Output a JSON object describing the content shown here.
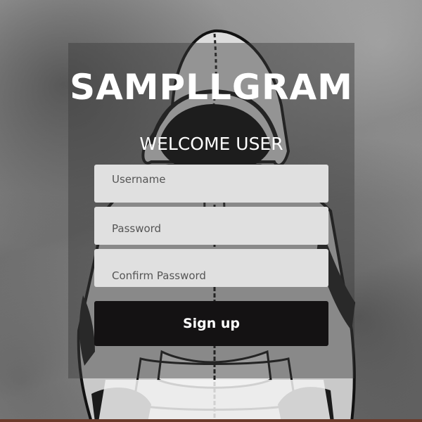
{
  "brand": {
    "logo_text": "SAMPLLGRAM"
  },
  "heading": {
    "welcome": "WELCOME USER"
  },
  "form": {
    "username_placeholder": "Username",
    "password_placeholder": "Password",
    "confirm_placeholder": "Confirm Password",
    "submit_label": "Sign up"
  },
  "colors": {
    "panel_overlay": "rgba(60,60,60,0.45)",
    "field_background": "#e0e0e0",
    "button_background": "#141213",
    "text_light": "#ffffff"
  },
  "background": {
    "illustration": "hooded-figure-illustration"
  }
}
